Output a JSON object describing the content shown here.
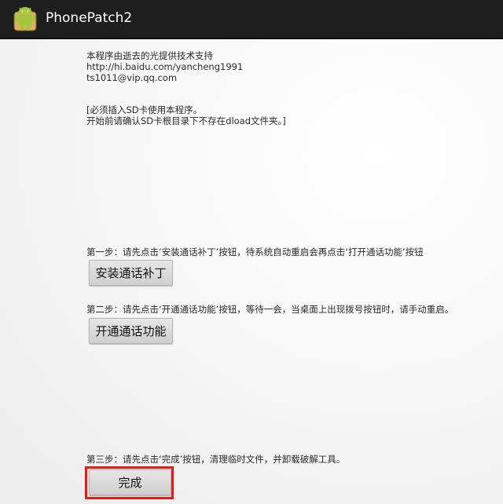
{
  "app": {
    "title": "PhonePatch2",
    "icon": "android-robot-icon"
  },
  "intro": {
    "line1": "本程序由逝去的光提供技术支持",
    "line2": "http://hi.baidu.com/yancheng1991",
    "line3": "ts1011@vip.qq.com"
  },
  "notice": {
    "line1": "[必须插入SD卡使用本程序。",
    "line2": "开始前请确认SD卡根目录下不存在dload文件夹。]"
  },
  "steps": [
    {
      "text": "第一步：请先点击‘安装通话补丁’按钮，待系统自动重启会再点击‘打开通话功能’按钮",
      "button": "安装通话补丁"
    },
    {
      "text": "第二步：请先点击‘开通通话功能’按钮，等待一会，当桌面上出现拨号按钮时，请手动重启。",
      "button": "开通通话功能"
    },
    {
      "text": "第三步：请先点击‘完成’按钮，清理临时文件，并卸载破解工具。",
      "button": "完成"
    }
  ],
  "colors": {
    "titlebar": "#1e1e1e",
    "highlight": "#e21b1b",
    "android_green": "#a4c639"
  }
}
